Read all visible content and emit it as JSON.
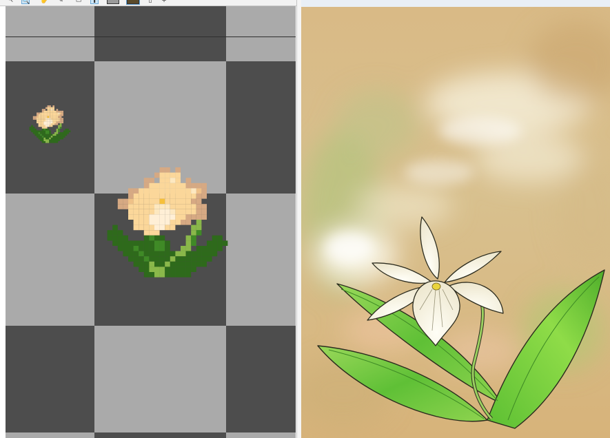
{
  "toolbar": {
    "tools": [
      {
        "icon": "pointer-icon",
        "glyph": "↖",
        "active": false
      },
      {
        "icon": "zoom-icon",
        "glyph": "🔍",
        "active": true
      },
      {
        "icon": "hand-icon",
        "glyph": "✋",
        "active": false
      },
      {
        "icon": "pencil-icon",
        "glyph": "✎",
        "active": false
      },
      {
        "icon": "frame-icon",
        "glyph": "▭",
        "active": false
      },
      {
        "icon": "arrow-tool-icon",
        "glyph": "⬆",
        "active": true
      },
      {
        "icon": "gray-swatch-icon",
        "glyph": "",
        "active": false
      },
      {
        "icon": "color-swatch-icon",
        "glyph": "",
        "active": true
      },
      {
        "icon": "doc-icon",
        "glyph": "▯",
        "active": false
      },
      {
        "icon": "plus-icon",
        "glyph": "+",
        "active": false
      }
    ]
  },
  "canvas": {
    "checker_dark": "#4d4d4d",
    "checker_light": "#aaaaaa",
    "guide_color": "#2e2e2e",
    "sprites": [
      {
        "name": "flower-sprite-small",
        "scale": "1x"
      },
      {
        "name": "flower-sprite-large",
        "scale": "3x"
      }
    ]
  },
  "reference": {
    "subject": "white-orchid-painting",
    "palette": {
      "background": "#d9b985",
      "leaf": "#6cc43a",
      "petal": "#f7f3e6",
      "center": "#e8d23a"
    }
  }
}
